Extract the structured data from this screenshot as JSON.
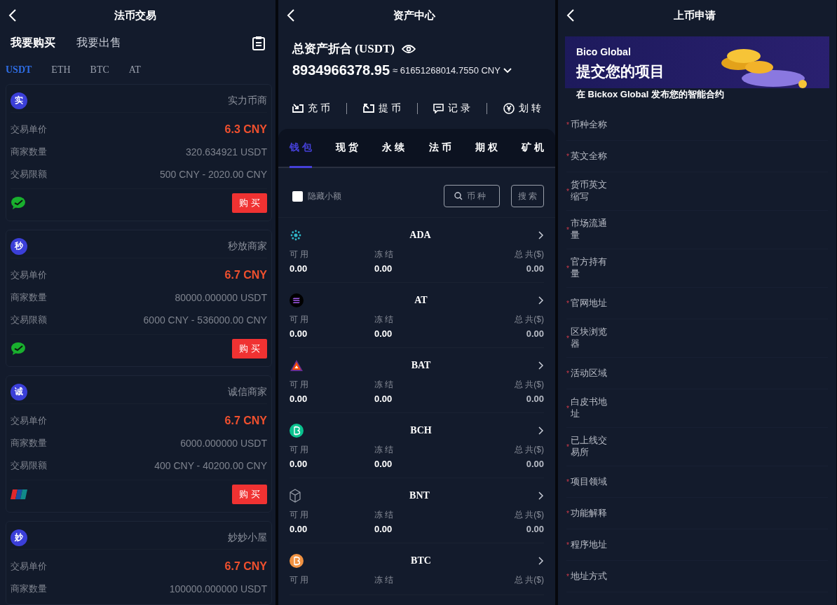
{
  "otc": {
    "title": "法币交易",
    "modes": [
      {
        "label": "我要购买",
        "selected": true
      },
      {
        "label": "我要出售",
        "selected": false
      }
    ],
    "coins": [
      {
        "label": "USDT",
        "selected": true
      },
      {
        "label": "ETH",
        "selected": false
      },
      {
        "label": "BTC",
        "selected": false
      },
      {
        "label": "AT",
        "selected": false
      }
    ],
    "merchants": [
      {
        "avatar": "实",
        "name": "实力币商",
        "rows": [
          {
            "label": "交易单价",
            "value": "6.3 CNY",
            "kind": "price"
          },
          {
            "label": "商家数量",
            "value": "320.634921 USDT",
            "kind": "plain"
          },
          {
            "label": "交易限额",
            "value": "500 CNY - 2020.00 CNY",
            "kind": "plain"
          }
        ],
        "kind": "wechat",
        "button": "购 买"
      },
      {
        "avatar": "秒",
        "name": "秒放商家",
        "rows": [
          {
            "label": "交易单价",
            "value": "6.7 CNY",
            "kind": "price"
          },
          {
            "label": "商家数量",
            "value": "80000.000000 USDT",
            "kind": "plain"
          },
          {
            "label": "交易限额",
            "value": "6000 CNY - 536000.00 CNY",
            "kind": "plain"
          }
        ],
        "kind": "wechat",
        "button": "购 买"
      },
      {
        "avatar": "诚",
        "name": "诚信商家",
        "rows": [
          {
            "label": "交易单价",
            "value": "6.7 CNY",
            "kind": "price"
          },
          {
            "label": "商家数量",
            "value": "6000.000000 USDT",
            "kind": "plain"
          },
          {
            "label": "交易限额",
            "value": "400 CNY - 40200.00 CNY",
            "kind": "plain"
          }
        ],
        "kind": "unionpay",
        "button": "购 买"
      },
      {
        "avatar": "妙",
        "name": "妙妙小屋",
        "rows": [
          {
            "label": "交易单价",
            "value": "6.7 CNY",
            "kind": "price"
          },
          {
            "label": "商家数量",
            "value": "100000.000000 USDT",
            "kind": "plain"
          }
        ]
      }
    ]
  },
  "assets": {
    "title": "资产中心",
    "total_label": "总资产折合 (USDT)",
    "total": "8934966378.95",
    "converted": "≈ 61651268014.7550 CNY",
    "actions": [
      {
        "label": "充 币",
        "kind": "deposit"
      },
      {
        "label": "提 币",
        "kind": "withdraw"
      },
      {
        "label": "记 录",
        "kind": "record"
      },
      {
        "label": "划 转",
        "kind": "transfer"
      }
    ],
    "tabs": [
      {
        "label": "钱 包",
        "selected": true
      },
      {
        "label": "现 货",
        "selected": false
      },
      {
        "label": "永 续",
        "selected": false
      },
      {
        "label": "法 币",
        "selected": false
      },
      {
        "label": "期 权",
        "selected": false
      },
      {
        "label": "矿 机",
        "selected": false
      }
    ],
    "hide_small": {
      "label": "隐藏小额",
      "checked": false
    },
    "search": {
      "placeholder": "币 种"
    },
    "search_button": "搜 索",
    "list": [
      {
        "kind": "ada",
        "name": "ADA",
        "cols": [
          {
            "label": "可 用",
            "value": "0.00"
          },
          {
            "label": "冻 结",
            "value": "0.00"
          },
          {
            "label": "总 共($)",
            "value": "0.00"
          }
        ]
      },
      {
        "kind": "sol",
        "name": "AT",
        "cols": [
          {
            "label": "可 用",
            "value": "0.00"
          },
          {
            "label": "冻 结",
            "value": "0.00"
          },
          {
            "label": "总 共($)",
            "value": "0.00"
          }
        ]
      },
      {
        "kind": "bat",
        "name": "BAT",
        "cols": [
          {
            "label": "可 用",
            "value": "0.00"
          },
          {
            "label": "冻 结",
            "value": "0.00"
          },
          {
            "label": "总 共($)",
            "value": "0.00"
          }
        ]
      },
      {
        "kind": "bch",
        "name": "BCH",
        "cols": [
          {
            "label": "可 用",
            "value": "0.00"
          },
          {
            "label": "冻 结",
            "value": "0.00"
          },
          {
            "label": "总 共($)",
            "value": "0.00"
          }
        ]
      },
      {
        "kind": "bnt",
        "name": "BNT",
        "cols": [
          {
            "label": "可 用",
            "value": "0.00"
          },
          {
            "label": "冻 结",
            "value": "0.00"
          },
          {
            "label": "总 共($)",
            "value": "0.00"
          }
        ]
      },
      {
        "kind": "btc",
        "name": "BTC",
        "cols": [
          {
            "label": "可 用"
          },
          {
            "label": "冻 结"
          },
          {
            "label": "总 共($)"
          }
        ]
      }
    ]
  },
  "listing": {
    "title": "上币申请",
    "banner": {
      "brand": "Bico Global",
      "headline": "提交您的项目",
      "subtitle": "在 Bickox Global 发布您的智能合约"
    },
    "fields": [
      {
        "label": "币种全称",
        "mark": "*"
      },
      {
        "label": "英文全称",
        "mark": "*"
      },
      {
        "label": "货币英文缩写",
        "mark": "*"
      },
      {
        "label": "市场流通量",
        "mark": "*"
      },
      {
        "label": "官方持有量",
        "mark": "*"
      },
      {
        "label": "官网地址",
        "mark": "*"
      },
      {
        "label": "区块浏览器",
        "mark": "*"
      },
      {
        "label": "活动区域",
        "mark": "*"
      },
      {
        "label": "白皮书地址",
        "mark": "*"
      },
      {
        "label": "已上线交易所",
        "mark": "*"
      },
      {
        "label": "项目领域",
        "mark": "*"
      },
      {
        "label": "功能解释",
        "mark": "*"
      },
      {
        "label": "程序地址",
        "mark": "*"
      },
      {
        "label": "地址方式",
        "mark": "*"
      }
    ]
  }
}
